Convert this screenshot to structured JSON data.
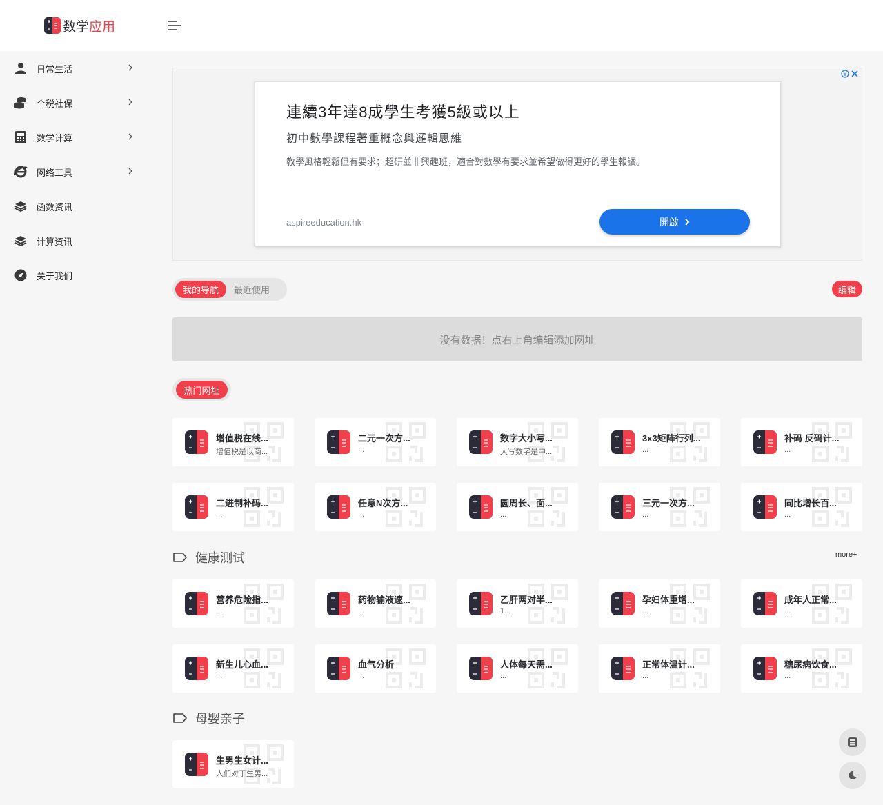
{
  "header": {
    "brand_part1": "数学",
    "brand_part2": "应用"
  },
  "sidebar": {
    "items": [
      {
        "label": "日常生活",
        "icon": "user-icon",
        "has_submenu": true
      },
      {
        "label": "个税社保",
        "icon": "coins-icon",
        "has_submenu": true
      },
      {
        "label": "数学计算",
        "icon": "calculator-icon",
        "has_submenu": true
      },
      {
        "label": "网络工具",
        "icon": "ie-browser-icon",
        "has_submenu": true
      },
      {
        "label": "函数资讯",
        "icon": "layers-icon",
        "has_submenu": false
      },
      {
        "label": "计算资讯",
        "icon": "layers-icon",
        "has_submenu": false
      },
      {
        "label": "关于我们",
        "icon": "compass-icon",
        "has_submenu": false
      }
    ]
  },
  "ad": {
    "title": "連續3年達8成學生考獲5級或以上",
    "subtitle": "初中數學課程著重概念與邏輯思維",
    "description": "教學風格輕鬆但有要求；超研並非興趣班，適合對數學有要求並希望做得更好的學生報讀。",
    "url": "aspireeducation.hk",
    "button_label": "開啟",
    "button_color": "#1a73e8"
  },
  "nav": {
    "tabs": [
      {
        "label": "我的导航",
        "active": true
      },
      {
        "label": "最近使用",
        "active": false
      }
    ],
    "edit_label": "编辑",
    "empty_message": "没有数据！点右上角编辑添加网址"
  },
  "hot": {
    "label": "热门网址",
    "cards": [
      {
        "title": "增值税在线...",
        "desc": "增值税是以商..."
      },
      {
        "title": "二元一次方...",
        "desc": "..."
      },
      {
        "title": "数字大小写...",
        "desc": "大写数字是中..."
      },
      {
        "title": "3x3矩阵行列...",
        "desc": "..."
      },
      {
        "title": "补码 反码计...",
        "desc": "..."
      },
      {
        "title": "二进制补码...",
        "desc": "..."
      },
      {
        "title": "任意N次方...",
        "desc": "..."
      },
      {
        "title": "圆周长、面...",
        "desc": "..."
      },
      {
        "title": "三元一次方...",
        "desc": "..."
      },
      {
        "title": "同比增长百...",
        "desc": "..."
      }
    ]
  },
  "health": {
    "title": "健康测试",
    "more_label": "more+",
    "cards": [
      {
        "title": "营养危险指...",
        "desc": "..."
      },
      {
        "title": "药物输液速...",
        "desc": "..."
      },
      {
        "title": "乙肝两对半...",
        "desc": "1..."
      },
      {
        "title": "孕妇体重增...",
        "desc": "..."
      },
      {
        "title": "成年人正常...",
        "desc": "..."
      },
      {
        "title": "新生儿心血...",
        "desc": "..."
      },
      {
        "title": "血气分析",
        "desc": "..."
      },
      {
        "title": "人体每天需...",
        "desc": "..."
      },
      {
        "title": "正常体温计...",
        "desc": "..."
      },
      {
        "title": "糖尿病饮食...",
        "desc": "..."
      }
    ]
  },
  "mother": {
    "title": "母婴亲子",
    "cards": [
      {
        "title": "生男生女计...",
        "desc": "人们对于生男..."
      }
    ]
  },
  "colors": {
    "accent": "#f1404b",
    "page_bg": "#f6f6f6",
    "logo_dark": "#2b2b3a"
  }
}
